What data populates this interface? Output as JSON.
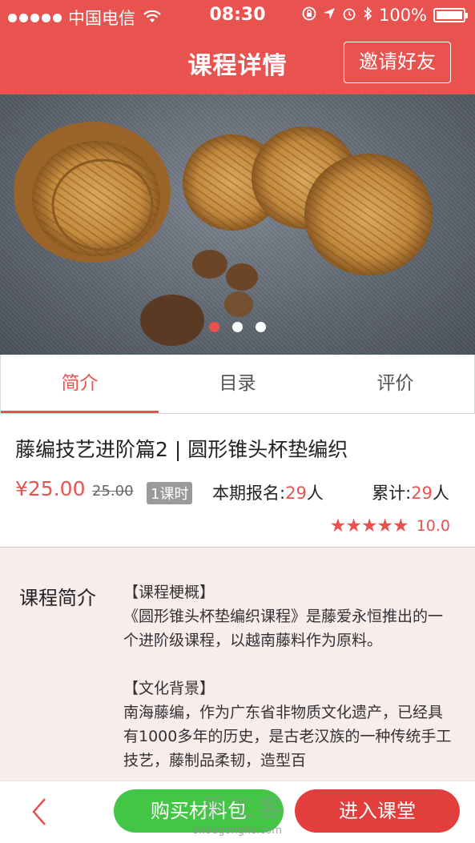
{
  "status_bar": {
    "carrier": "中国电信",
    "time": "08:30",
    "battery": "100%"
  },
  "header": {
    "title": "课程详情",
    "invite_label": "邀请好友"
  },
  "carousel": {
    "page_count": 3,
    "active_index": 0
  },
  "tabs": [
    {
      "label": "简介",
      "active": true
    },
    {
      "label": "目录",
      "active": false
    },
    {
      "label": "评价",
      "active": false
    }
  ],
  "course": {
    "title": "藤编技艺进阶篇2 | 圆形锥头杯垫编织",
    "price": "¥25.00",
    "original_price": "25.00",
    "lessons": "1课时",
    "enroll_label": "本期报名:",
    "enroll_count": "29",
    "enroll_unit": "人",
    "total_label": "累计:",
    "total_count": "29",
    "total_unit": "人",
    "stars": 5,
    "score": "10.0"
  },
  "intro": {
    "label": "课程简介",
    "heading1": "【课程梗概】",
    "para1": "《圆形锥头杯垫编织课程》是藤爱永恒推出的一个进阶级课程，以越南藤料作为原料。",
    "heading2": "【文化背景】",
    "para2": "南海藤编，作为广东省非物质文化遗产，已经具有1000多年的历史，是古老汉族的一种传统手工技艺，藤制品柔韧，造型百"
  },
  "bottom_bar": {
    "buy_label": "购买材料包",
    "enter_label": "进入课堂"
  },
  "watermark": {
    "text": "手工客",
    "url": "shougongke.com"
  },
  "colors": {
    "brand_red": "#e9534f",
    "buy_green": "#43c545",
    "enter_red": "#e23e3b"
  }
}
